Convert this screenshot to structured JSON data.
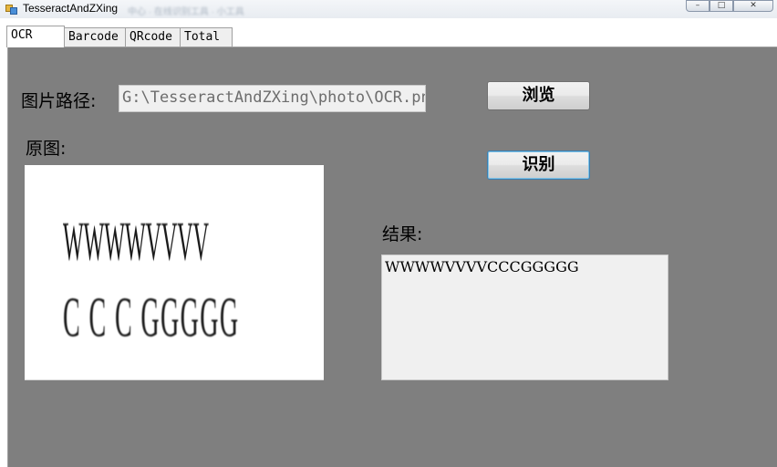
{
  "window": {
    "title": "TesseractAndZXing",
    "background_tabs_text": "中心 · 在线识别工具 · 小工具",
    "controls": {
      "minimize": "–",
      "maximize": "□",
      "close": "✕"
    }
  },
  "tabs": [
    {
      "label": "OCR",
      "active": true
    },
    {
      "label": "Barcode",
      "active": false
    },
    {
      "label": "QRcode",
      "active": false
    },
    {
      "label": "Total",
      "active": false
    }
  ],
  "ocr_page": {
    "path_label": "图片路径:",
    "path_value": "G:\\TesseractAndZXing\\photo\\OCR.png",
    "browse_button": "浏览",
    "recognize_button": "识别",
    "original_label": "原图:",
    "image_lines": [
      "WWWWVVVV",
      "C C C GGGGG"
    ],
    "result_label": "结果:",
    "result_text": "WWWWVVVVCCCGGGGG"
  },
  "colors": {
    "page_background": "#7f7f7f",
    "field_background": "#f0f0f0",
    "focus_border": "#3c7fb1"
  },
  "icons": {
    "app": "app-icon"
  }
}
